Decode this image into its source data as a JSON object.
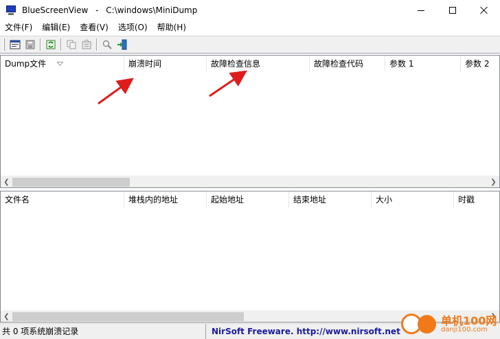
{
  "window": {
    "app_name": "BlueScreenView",
    "separator": "-",
    "path": "C:\\windows\\MiniDump"
  },
  "menu": [
    {
      "label": "文件(F)"
    },
    {
      "label": "编辑(E)"
    },
    {
      "label": "查看(V)"
    },
    {
      "label": "选项(O)"
    },
    {
      "label": "帮助(H)"
    }
  ],
  "toolbar": {
    "icons": [
      "properties-icon",
      "save-icon",
      "refresh-icon",
      "copy-icon",
      "html-report-icon",
      "find-icon",
      "exit-icon"
    ]
  },
  "top_table": {
    "columns": [
      {
        "label": "Dump文件"
      },
      {
        "label": "崩溃时间"
      },
      {
        "label": "故障检查信息"
      },
      {
        "label": "故障检查代码"
      },
      {
        "label": "参数 1"
      },
      {
        "label": "参数 2"
      }
    ],
    "scroll_fraction": 0.24
  },
  "bottom_table": {
    "columns": [
      {
        "label": "文件名"
      },
      {
        "label": "堆栈内的地址"
      },
      {
        "label": "起始地址"
      },
      {
        "label": "结束地址"
      },
      {
        "label": "大小"
      },
      {
        "label": "时戳"
      }
    ],
    "scroll_fraction": 0.48
  },
  "status": {
    "count_text": "共 0 项系统崩溃记录",
    "link_text": "NirSoft Freeware.  http://www.nirsoft.net"
  },
  "watermark": {
    "title": "单机100网",
    "url": "danji100.com"
  },
  "colors": {
    "annotation_arrow": "#e01b1b",
    "link": "#1b1b9f",
    "watermark": "#f07a1a"
  }
}
